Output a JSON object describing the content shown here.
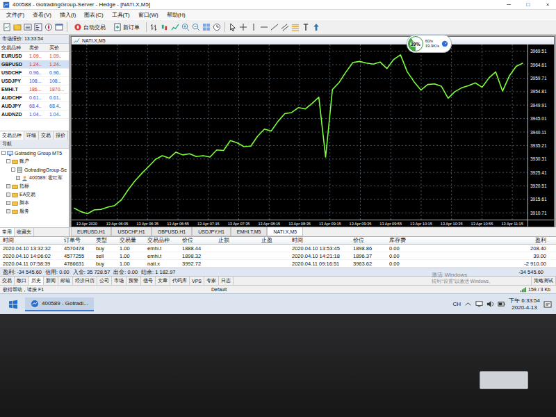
{
  "window": {
    "title": "400588 - GotradingGroup-Server - Hedge - [NATI.X,M5]",
    "controls": [
      "─",
      "□",
      "×"
    ]
  },
  "menu": [
    "文件(F)",
    "查看(V)",
    "插入(I)",
    "图表(C)",
    "工具(T)",
    "窗口(W)",
    "帮助(H)"
  ],
  "toolbar": {
    "buttons": [
      "自动交易",
      "新订单"
    ]
  },
  "market_watch": {
    "title": "市场报价: 13:33:54",
    "columns": [
      "交易品种",
      "卖价",
      "买价"
    ],
    "rows": [
      {
        "symbol": "EURUSD",
        "bid": "1.09..",
        "ask": "1.09..",
        "selected": false,
        "color": "#c0392b"
      },
      {
        "symbol": "GBPUSD",
        "bid": "1.24..",
        "ask": "1.24..",
        "selected": true,
        "color": "#c0392b"
      },
      {
        "symbol": "USDCHF",
        "bid": "0.96..",
        "ask": "0.96..",
        "selected": false,
        "color": "#1f4fbf"
      },
      {
        "symbol": "USDJPY",
        "bid": "108...",
        "ask": "108...",
        "selected": false,
        "color": "#1f4fbf"
      },
      {
        "symbol": "EMHI.T",
        "bid": "186...",
        "ask": "1870...",
        "selected": false,
        "color": "#c0392b"
      },
      {
        "symbol": "AUDCHF",
        "bid": "0.61..",
        "ask": "0.61..",
        "selected": false,
        "color": "#1f4fbf"
      },
      {
        "symbol": "AUDJPY",
        "bid": "68.4..",
        "ask": "68.4..",
        "selected": false,
        "color": "#1f4fbf"
      },
      {
        "symbol": "AUDNZD",
        "bid": "1.04..",
        "ask": "1.04..",
        "selected": false,
        "color": "#1f4fbf"
      }
    ],
    "tabs": [
      {
        "label": "交易品种",
        "selected": true
      },
      {
        "label": "详细",
        "selected": false
      },
      {
        "label": "交易",
        "selected": false
      },
      {
        "label": "报价",
        "selected": false
      }
    ]
  },
  "navigator": {
    "title": "导航",
    "items": [
      {
        "label": "Gotrading Group MT5",
        "kind": "root",
        "depth": 0,
        "expanded": true
      },
      {
        "label": "账户",
        "kind": "folder",
        "depth": 1,
        "expanded": true
      },
      {
        "label": "GotradingGroup-Se",
        "kind": "server",
        "depth": 2,
        "expanded": true
      },
      {
        "label": "400589: 霍红军",
        "kind": "account",
        "depth": 3,
        "expanded": false
      },
      {
        "label": "指标",
        "kind": "folder",
        "depth": 1,
        "expanded": false
      },
      {
        "label": "EA交易",
        "kind": "folder",
        "depth": 1,
        "expanded": false
      },
      {
        "label": "脚本",
        "kind": "folder",
        "depth": 1,
        "expanded": false
      },
      {
        "label": "服务",
        "kind": "folder",
        "depth": 1,
        "expanded": false
      }
    ],
    "tabs": [
      {
        "label": "常用",
        "selected": true
      },
      {
        "label": "收藏夹",
        "selected": false
      }
    ]
  },
  "chart": {
    "title": "NATI.X,M5",
    "price_ticks": [
      "3969.51",
      "3964.61",
      "3959.71",
      "3954.81",
      "3949.91",
      "3945.01",
      "3940.11",
      "3935.21",
      "3930.31",
      "3925.41",
      "3920.51",
      "3915.61",
      "3910.71"
    ],
    "time_ticks": [
      "13 Apr 2020",
      "13 Apr 06:05",
      "13 Apr 06:35",
      "13 Apr 06:55",
      "13 Apr 07:15",
      "13 Apr 07:35",
      "13 Apr 08:15",
      "13 Apr 08:35",
      "13 Apr 09:15",
      "13 Apr 09:35",
      "13 Apr 09:55",
      "13 Apr 10:15",
      "13 Apr 10:35",
      "13 Apr 10:55",
      "13 Apr 11:15"
    ],
    "series": [
      {
        "name": "NATI.X",
        "color": "#7cff3a",
        "values": [
          3912.5,
          3911.2,
          3910.4,
          3911.8,
          3912.0,
          3912.8,
          3913.4,
          3915.5,
          3919.2,
          3922.4,
          3925.1,
          3927.6,
          3930.2,
          3931.5,
          3930.6,
          3932.8,
          3931.8,
          3932.2,
          3931.2,
          3931.5,
          3931.0,
          3933.6,
          3933.4,
          3937.0,
          3936.2,
          3934.8,
          3935.0,
          3938.6,
          3941.2,
          3940.5,
          3944.0,
          3946.8,
          3947.2,
          3949.0,
          3948.5,
          3950.5,
          3952.8,
          3931.0,
          3955.6,
          3958.2,
          3962.0,
          3965.4,
          3965.8,
          3965.2,
          3964.8,
          3965.6,
          3963.2,
          3966.5,
          3968.2,
          3962.0,
          3958.4,
          3955.4,
          3957.4,
          3957.6,
          3956.8,
          3952.4,
          3954.8,
          3956.2,
          3957.0,
          3958.0,
          3956.4,
          3959.8,
          3962.0,
          3955.0,
          3960.5,
          3964.0,
          3965.2
        ]
      }
    ]
  },
  "net_monitor": {
    "percent": "39%",
    "level": 0.39,
    "up": "60/s",
    "down": "19.9K/s"
  },
  "chart_tabs": [
    {
      "label": "EURUSD,H1",
      "selected": false
    },
    {
      "label": "USDCHF,H1",
      "selected": false
    },
    {
      "label": "GBPUSD,H1",
      "selected": false
    },
    {
      "label": "USDJPY,H1",
      "selected": false
    },
    {
      "label": "EMHI.T,M5",
      "selected": false
    },
    {
      "label": "NATI.X,M5",
      "selected": true
    }
  ],
  "orders": {
    "columns": [
      "时间",
      "订单号",
      "类型",
      "交易量",
      "交易品种",
      "价位",
      "止损",
      "止盈",
      "时间",
      "价位",
      "库存费",
      "盈利"
    ],
    "rows": [
      {
        "cells": [
          "2020.04.10 13:32:32",
          "4570478",
          "buy",
          "1.00",
          "emhi.t",
          "1888.44",
          "",
          "",
          "2020.04.10 13:53:45",
          "1898.86",
          "0.00",
          "208.40"
        ],
        "selected": false
      },
      {
        "cells": [
          "2020.04.10 14:06:02",
          "4577255",
          "sell",
          "1.00",
          "emhi.t",
          "1898.32",
          "",
          "",
          "2020.04.10 14:21:18",
          "1896.37",
          "0.00",
          "39.00"
        ],
        "selected": false
      },
      {
        "cells": [
          "2020.04.11 07:58:39",
          "4786631",
          "buy",
          "1.00",
          "nati.x",
          "3992.72",
          "",
          "",
          "2020.04.11 09:16:51",
          "3963.62",
          "0.00",
          "-2 910.00"
        ],
        "selected": false
      }
    ]
  },
  "summary": {
    "items": [
      "盈利: -34 545.60",
      "信用: 0.00",
      "入金: 35 728.57",
      "出金: 0.00",
      "结余: 1 182.97"
    ],
    "total": "-34 545.60"
  },
  "terminal_tabs": [
    {
      "label": "交易",
      "selected": false
    },
    {
      "label": "敞口",
      "selected": false
    },
    {
      "label": "历史",
      "selected": true
    },
    {
      "label": "新闻",
      "selected": false
    },
    {
      "label": "邮箱",
      "selected": false
    },
    {
      "label": "经济日历",
      "selected": false
    },
    {
      "label": "公司",
      "selected": false
    },
    {
      "label": "市场",
      "selected": false
    },
    {
      "label": "预警",
      "selected": false
    },
    {
      "label": "信号",
      "selected": false
    },
    {
      "label": "文章",
      "selected": false
    },
    {
      "label": "代码库",
      "selected": false
    },
    {
      "label": "VPS",
      "selected": false
    },
    {
      "label": "专家",
      "selected": false
    },
    {
      "label": "日志",
      "selected": false
    }
  ],
  "tester_tab": "策略测试",
  "watermark": [
    "激活 Windows",
    "转到“设置”以激活 Windows。"
  ],
  "status_bar": {
    "help": "获得帮助，请按 F1",
    "profile": "Default",
    "traffic": "159 / 3 Kb"
  },
  "taskbar": {
    "apps": [
      {
        "label": "400589 - Gotradi...",
        "selected": true
      }
    ],
    "ime": "CH",
    "time": "下午 6:33:54",
    "date": "2020-4-13"
  }
}
